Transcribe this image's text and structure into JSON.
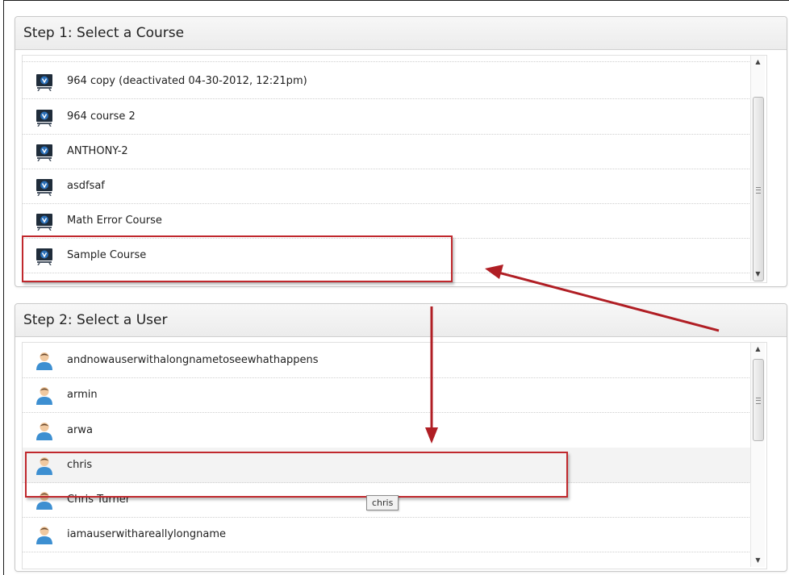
{
  "step1": {
    "title": "Step 1: Select a Course",
    "items": [
      {
        "label": "964 copy (deactivated 04-30-2012, 12:21pm)"
      },
      {
        "label": "964 course 2"
      },
      {
        "label": "ANTHONY-2"
      },
      {
        "label": "asdfsaf"
      },
      {
        "label": "Math Error Course"
      },
      {
        "label": "Sample Course"
      }
    ],
    "icon": "course-presentation-icon"
  },
  "step2": {
    "title": "Step 2: Select a User",
    "items": [
      {
        "label": "andnowauserwithalongnametoseewhathappens"
      },
      {
        "label": "armin"
      },
      {
        "label": "arwa"
      },
      {
        "label": "chris"
      },
      {
        "label": "Chris Turner"
      },
      {
        "label": "iamauserwithareallylongname"
      }
    ],
    "icon": "user-avatar-icon"
  },
  "tooltip": "chris",
  "colors": {
    "highlight": "#c0282d",
    "arrow": "#b01e24",
    "course_icon_blue": "#2a6fb8",
    "user_icon_blue": "#3d8fd1"
  }
}
